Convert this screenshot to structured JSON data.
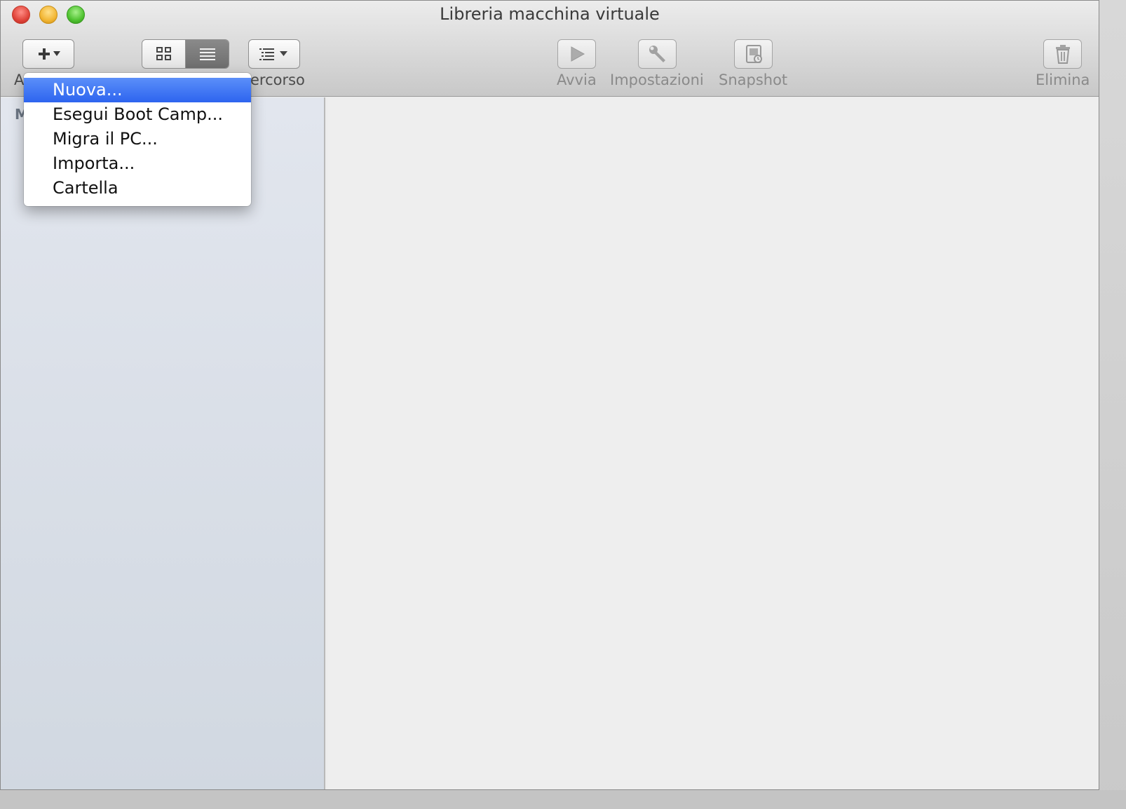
{
  "window": {
    "title": "Libreria macchina virtuale"
  },
  "toolbar": {
    "add_label": "A",
    "path_label": "ercorso",
    "start_label": "Avvia",
    "settings_label": "Impostazioni",
    "snapshot_label": "Snapshot",
    "delete_label": "Elimina"
  },
  "sidebar": {
    "heading": "M"
  },
  "add_menu": {
    "items": [
      {
        "label": "Nuova..."
      },
      {
        "label": "Esegui Boot Camp..."
      },
      {
        "label": "Migra il PC..."
      },
      {
        "label": "Importa..."
      },
      {
        "label": "Cartella"
      }
    ]
  },
  "colors": {
    "menu_highlight": "#3a70f2",
    "sidebar_bg": "#dde2ea",
    "content_bg": "#eeeeee"
  },
  "icons": {
    "add": "plus-icon",
    "grid_view": "grid-icon",
    "list_view": "list-icon",
    "sort": "outline-icon",
    "start": "play-icon",
    "settings": "wrench-icon",
    "snapshot": "snapshot-icon",
    "delete": "trash-icon"
  }
}
